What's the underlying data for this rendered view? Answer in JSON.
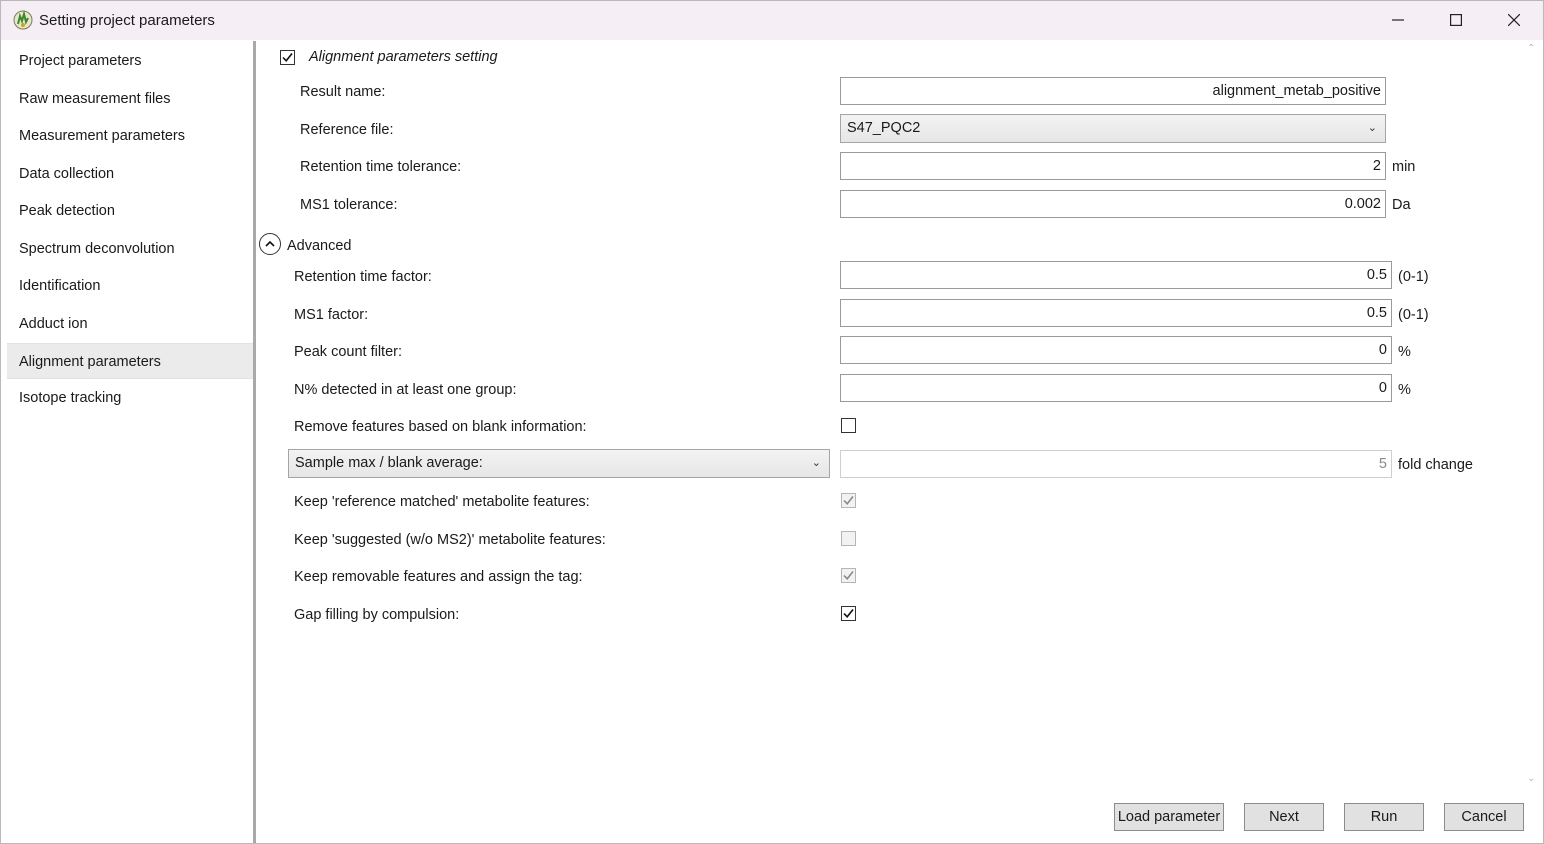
{
  "window": {
    "title": "Setting project parameters",
    "icons": {
      "app": "app-logo-icon",
      "minimize": "minimize-icon",
      "maximize": "maximize-icon",
      "close": "close-icon"
    }
  },
  "sidebar": {
    "items": [
      {
        "label": "Project parameters"
      },
      {
        "label": "Raw measurement files"
      },
      {
        "label": "Measurement parameters"
      },
      {
        "label": "Data collection"
      },
      {
        "label": "Peak detection"
      },
      {
        "label": "Spectrum deconvolution"
      },
      {
        "label": "Identification"
      },
      {
        "label": "Adduct ion"
      },
      {
        "label": "Alignment parameters",
        "selected": true
      },
      {
        "label": "Isotope tracking"
      }
    ]
  },
  "alignment": {
    "enabled_label": "Alignment parameters setting",
    "enabled": true,
    "result_name": {
      "label": "Result name:",
      "value": "alignment_metab_positive"
    },
    "reference_file": {
      "label": "Reference file:",
      "value": "S47_PQC2"
    },
    "rt_tolerance": {
      "label": "Retention time tolerance:",
      "value": "2",
      "unit": "min"
    },
    "ms1_tolerance": {
      "label": "MS1 tolerance:",
      "value": "0.002",
      "unit": "Da"
    }
  },
  "advanced": {
    "label": "Advanced",
    "expanded": true,
    "rt_factor": {
      "label": "Retention time factor:",
      "value": "0.5",
      "unit": "(0-1)"
    },
    "ms1_factor": {
      "label": "MS1 factor:",
      "value": "0.5",
      "unit": "(0-1)"
    },
    "peak_count_filter": {
      "label": "Peak count filter:",
      "value": "0",
      "unit": "%"
    },
    "n_percent_detected": {
      "label": "N% detected in at least one group:",
      "value": "0",
      "unit": "%"
    },
    "remove_blank": {
      "label": "Remove features based on blank information:",
      "checked": false
    },
    "blank_method": {
      "value": "Sample max / blank average:",
      "fold_value": "5",
      "fold_unit": "fold change"
    },
    "keep_reference_matched": {
      "label": "Keep 'reference matched' metabolite features:",
      "checked": true,
      "disabled": true
    },
    "keep_suggested": {
      "label": "Keep 'suggested (w/o MS2)' metabolite features:",
      "checked": false,
      "disabled": true
    },
    "keep_removable": {
      "label": "Keep removable features and assign the tag:",
      "checked": true,
      "disabled": true
    },
    "gap_filling": {
      "label": "Gap filling by compulsion:",
      "checked": true,
      "disabled": false
    }
  },
  "buttons": {
    "load_parameter": "Load parameter",
    "next": "Next",
    "run": "Run",
    "cancel": "Cancel"
  }
}
